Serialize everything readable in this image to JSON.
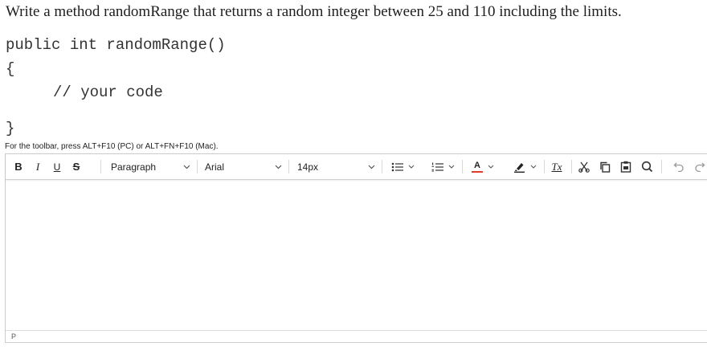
{
  "question": {
    "text": "Write a method randomRange that returns a random integer between 25 and 110 including the limits."
  },
  "code": {
    "signature": "public int randomRange()",
    "open_brace": "{",
    "comment": "// your code",
    "close_brace": "}"
  },
  "editor": {
    "toolbar_hint": "For the toolbar, press ALT+F10 (PC) or ALT+FN+F10 (Mac).",
    "toolbar": {
      "bold": "B",
      "italic": "I",
      "underline": "U",
      "strikethrough": "S",
      "block_format": "Paragraph",
      "font_family": "Arial",
      "font_size": "14px",
      "text_color_letter": "A",
      "clear_format": "Tx"
    },
    "status_path": "P",
    "colors": {
      "text_color_bar": "#e03e2d",
      "border": "#cccccc"
    }
  }
}
